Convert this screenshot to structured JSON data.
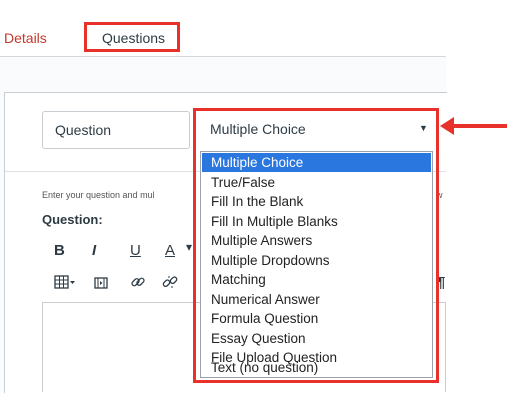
{
  "tabs": {
    "details": "Details",
    "questions": "Questions"
  },
  "question_name": "Question",
  "question_type": {
    "selected": "Multiple Choice",
    "options": [
      "Multiple Choice",
      "True/False",
      "Fill In the Blank",
      "Fill In Multiple Blanks",
      "Multiple Answers",
      "Multiple Dropdowns",
      "Matching",
      "Numerical Answer",
      "Formula Question",
      "Essay Question",
      "File Upload Question",
      "Text (no question)"
    ]
  },
  "editor": {
    "instructions": "Enter your question and mul",
    "instructions_tail": "w",
    "question_label": "Question:"
  },
  "toolbar": {
    "bold": "B",
    "italic": "I",
    "underline": "U",
    "font_color": "A",
    "more": "¶",
    "icons": [
      "table-icon",
      "media-icon",
      "link-icon",
      "unlink-icon",
      "paragraph-icon"
    ]
  },
  "colors": {
    "highlight": "#e8312b",
    "selected_option": "#2a77e0",
    "tab_link": "#c0392b"
  }
}
